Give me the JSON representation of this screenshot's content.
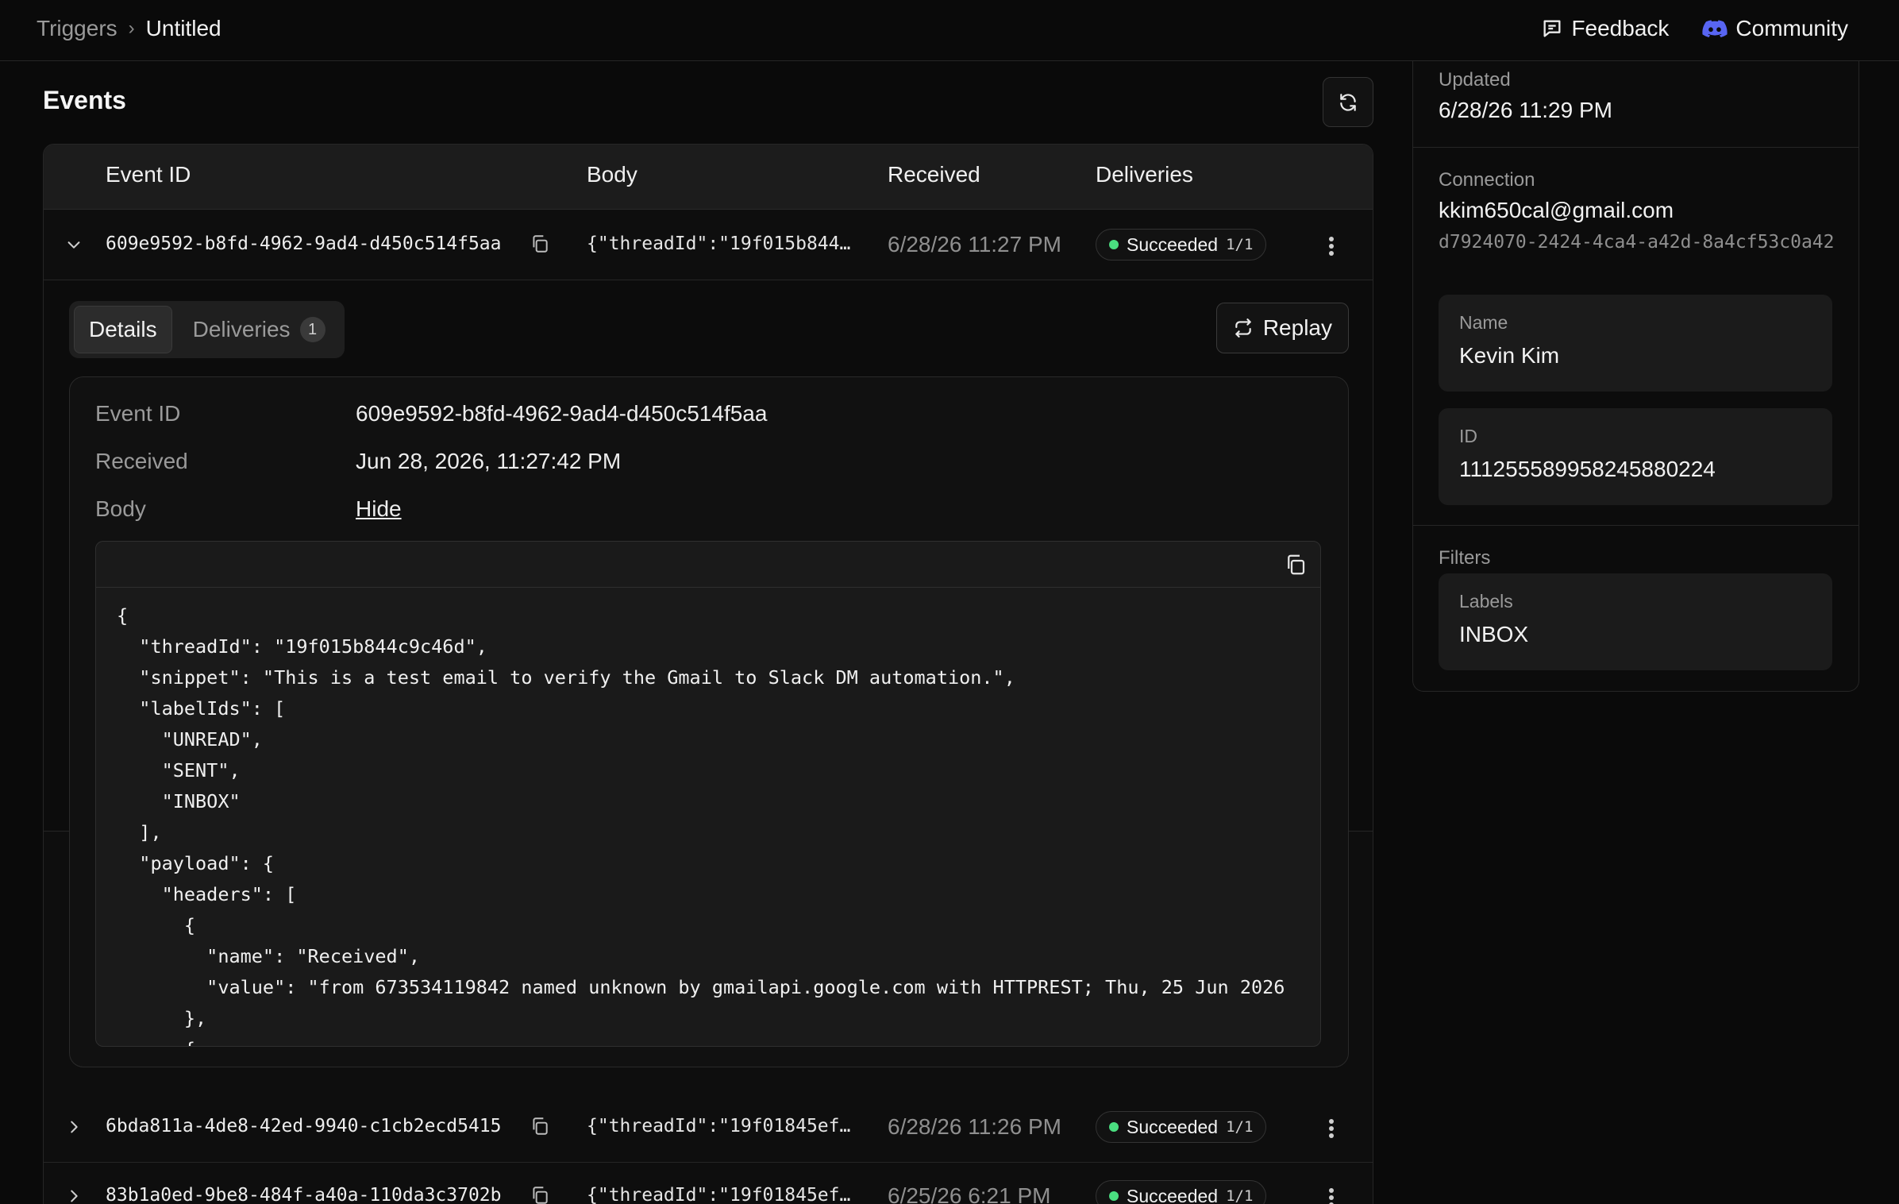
{
  "breadcrumb": {
    "parent": "Triggers",
    "current": "Untitled"
  },
  "toplinks": {
    "feedback": "Feedback",
    "community": "Community"
  },
  "events": {
    "title": "Events",
    "columns": {
      "event_id": "Event ID",
      "body": "Body",
      "received": "Received",
      "deliveries": "Deliveries"
    },
    "rows": [
      {
        "id": "609e9592-b8fd-4962-9ad4-d450c514f5aa",
        "body": "{\"threadId\":\"19f015b844…",
        "received": "6/28/26 11:27 PM",
        "status": "Succeeded",
        "deliveries": "1/1"
      },
      {
        "id": "6bda811a-4de8-42ed-9940-c1cb2ecd5415",
        "body": "{\"threadId\":\"19f01845ef…",
        "received": "6/28/26 11:26 PM",
        "status": "Succeeded",
        "deliveries": "1/1"
      },
      {
        "id": "83b1a0ed-9be8-484f-a40a-110da3c3702b",
        "body": "{\"threadId\":\"19f01845ef…",
        "received": "6/25/26 6:21 PM",
        "status": "Succeeded",
        "deliveries": "1/1"
      }
    ]
  },
  "detail": {
    "tabs": {
      "details": "Details",
      "deliveries": "Deliveries",
      "deliveries_count": "1"
    },
    "replay": "Replay",
    "labels": {
      "event_id": "Event ID",
      "received": "Received",
      "body": "Body"
    },
    "values": {
      "event_id": "609e9592-b8fd-4962-9ad4-d450c514f5aa",
      "received": "Jun 28, 2026, 11:27:42 PM",
      "body_toggle": "Hide"
    },
    "code": "{\n  \"threadId\": \"19f015b844c9c46d\",\n  \"snippet\": \"This is a test email to verify the Gmail to Slack DM automation.\",\n  \"labelIds\": [\n    \"UNREAD\",\n    \"SENT\",\n    \"INBOX\"\n  ],\n  \"payload\": {\n    \"headers\": [\n      {\n        \"name\": \"Received\",\n        \"value\": \"from 673534119842 named unknown by gmailapi.google.com with HTTPREST; Thu, 25 Jun 2026\n      },\n      {"
  },
  "side": {
    "updated_label": "Updated",
    "updated_value": "6/28/26 11:29 PM",
    "connection_label": "Connection",
    "connection_email": "kkim650cal@gmail.com",
    "connection_id": "d7924070-2424-4ca4-a42d-8a4cf53c0a42",
    "name_label": "Name",
    "name_value": "Kevin Kim",
    "id_label": "ID",
    "id_value": "111255589958245880224",
    "filters_label": "Filters",
    "labels_label": "Labels",
    "labels_value": "INBOX"
  },
  "colors": {
    "success": "#4ade80",
    "discord": "#5865F2"
  }
}
